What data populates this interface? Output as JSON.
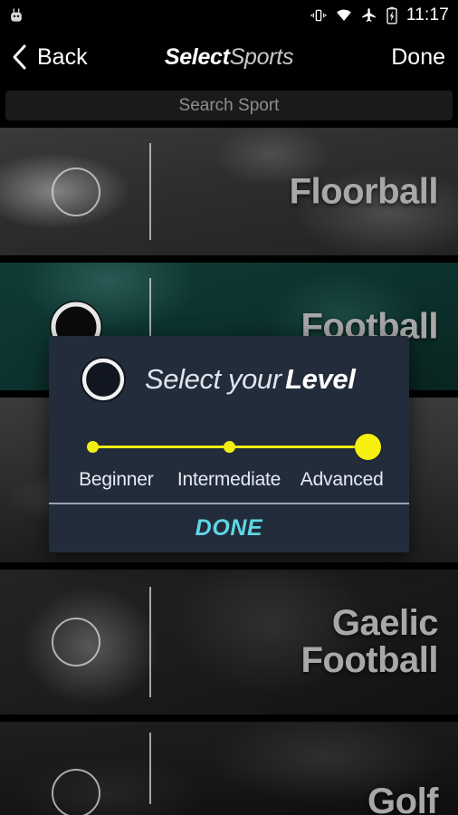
{
  "statusbar": {
    "notification_icon": "android-robot-icon",
    "icons": [
      "vibrate-icon",
      "wifi-icon",
      "airplane-mode-icon",
      "battery-charging-icon"
    ],
    "time": "11:17"
  },
  "header": {
    "back_icon": "chevron-left-icon",
    "back_label": "Back",
    "title_primary": "Select",
    "title_secondary": "Sports",
    "done_label": "Done"
  },
  "search": {
    "placeholder": "Search Sport",
    "value": ""
  },
  "sports": [
    {
      "name": "Floorball",
      "selected": false,
      "marker": "empty-circle",
      "bg": "bg-floorball"
    },
    {
      "name": "Football",
      "selected": true,
      "marker": "soccer-ball-icon",
      "bg": "bg-football"
    },
    {
      "name": "",
      "selected": false,
      "marker": "empty-circle",
      "bg": "bg-frisbee"
    },
    {
      "name": "Gaelic\nFootball",
      "selected": false,
      "marker": "empty-circle",
      "bg": "bg-gaelic"
    },
    {
      "name": "Golf",
      "selected": false,
      "marker": "empty-circle",
      "bg": "bg-golf"
    }
  ],
  "modal": {
    "icon": "soccer-ball-icon",
    "title_primary": "Select your",
    "title_secondary": "Level",
    "levels": [
      "Beginner",
      "Intermediate",
      "Advanced"
    ],
    "selected_level": "Advanced",
    "selected_index": 2,
    "done_label": "DONE",
    "accent_color": "#f2ee12",
    "done_color": "#5ed6e6",
    "background_color": "#222c3a"
  }
}
